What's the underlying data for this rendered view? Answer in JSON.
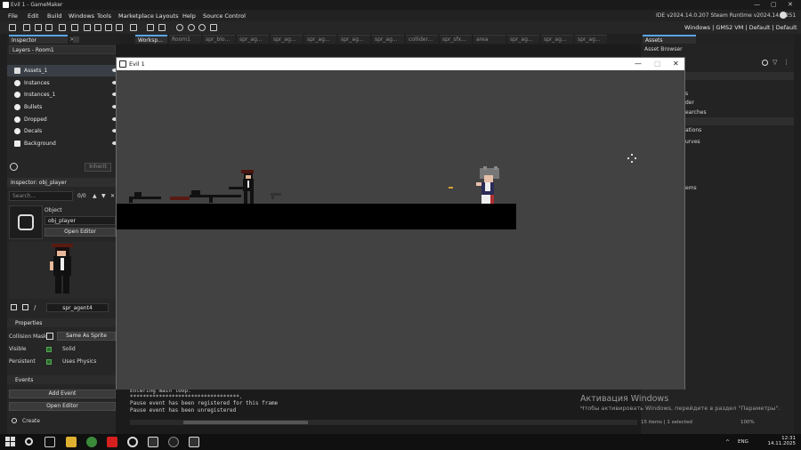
{
  "window": {
    "title": "Evil 1 - GameMaker",
    "controls": [
      "—",
      "▢",
      "✕"
    ]
  },
  "menu": [
    "File",
    "Edit",
    "Build",
    "Windows",
    "Tools",
    "Marketplace",
    "Layouts",
    "Help",
    "Source Control"
  ],
  "version_info": "IDE v2024.14.0.207 Steam  Runtime v2024.14.0.251",
  "status_right": "Windows | GMS2 VM | Default | Default",
  "inspector": {
    "tabs": [
      "Inspector"
    ],
    "layers_header": "Layers - Room1",
    "layers": [
      {
        "label": "Assets_1",
        "icon": "asset-layer-icon"
      },
      {
        "label": "Instances",
        "icon": "instance-layer-icon"
      },
      {
        "label": "Instances_1",
        "icon": "instance-layer-icon"
      },
      {
        "label": "Bullets",
        "icon": "instance-layer-icon"
      },
      {
        "label": "Dropped",
        "icon": "instance-layer-icon"
      },
      {
        "label": "Decals",
        "icon": "instance-layer-icon"
      },
      {
        "label": "Background",
        "icon": "background-layer-icon"
      }
    ],
    "inherit_button": "Inherit",
    "object_inspector_title": "Inspector: obj_player",
    "search_placeholder": "Search...",
    "search_count": "0/0",
    "object_label": "Object",
    "object_name": "obj_player",
    "open_editor": "Open Editor",
    "sprite_name": "spr_agent4",
    "properties_header": "Properties",
    "collision_mask_label": "Collision Mask",
    "collision_mask_value": "Same As Sprite",
    "visible_label": "Visible",
    "solid_label": "Solid",
    "persistent_label": "Persistent",
    "uses_physics_label": "Uses Physics",
    "events_header": "Events",
    "add_event": "Add Event",
    "open_editor_2": "Open Editor",
    "create_event": "Create"
  },
  "workspace_tabs": [
    "Worksp...",
    "Room1",
    "spr_blo...",
    "spr_ag...",
    "spr_ag...",
    "spr_ag...",
    "spr_ag...",
    "spr_ag...",
    "collider...",
    "spr_sfx...",
    "area",
    "spr_ag...",
    "spr_ag...",
    "spr_ag..."
  ],
  "output_lines": [
    "Entering main loop.",
    "**********************************.",
    "Pause event has been registered for this frame",
    "Pause event has been unregistered"
  ],
  "assets": {
    "tabs": [
      "Assets"
    ],
    "header": "Asset Browser",
    "visible_fragments": [
      "s",
      "der",
      "earches",
      "ations",
      "urves",
      "ems"
    ],
    "status": "15 items  |  1 selected",
    "zoom": "100%"
  },
  "game_window": {
    "title": "Evil 1",
    "controls": [
      "—",
      "▢",
      "✕"
    ]
  },
  "activation": {
    "title": "Активация Windows",
    "subtitle": "Чтобы активировать Windows, перейдите в раздел \"Параметры\"."
  },
  "taskbar": {
    "lang": "ENG",
    "time": "12:31",
    "date": "14.11.2025"
  }
}
